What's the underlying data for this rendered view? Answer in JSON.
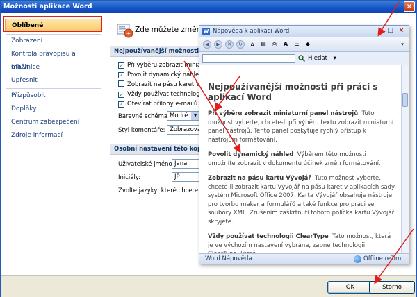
{
  "dialog": {
    "title": "Možnosti aplikace Word",
    "close": "×"
  },
  "nav": {
    "items": [
      {
        "label": "Oblíbené"
      },
      {
        "label": "Zobrazení"
      },
      {
        "label": "Kontrola pravopisu a mluvnice"
      },
      {
        "label": "Uložit"
      },
      {
        "label": "Upřesnit"
      },
      {
        "label": "Přizpůsobit"
      },
      {
        "label": "Doplňky"
      },
      {
        "label": "Centrum zabezpečení"
      },
      {
        "label": "Zdroje informací"
      }
    ]
  },
  "content": {
    "intro": "Zde můžete změnit ne",
    "section1": "Nejpoužívanější možnosti pro pr",
    "checks": [
      {
        "label": "Při výběru zobrazit miniatur",
        "checked": true
      },
      {
        "label": "Povolit dynamický náhled",
        "checked": true
      },
      {
        "label": "Zobrazit na pásu karet Vývo",
        "checked": false
      },
      {
        "label": "Vždy používat technologii C",
        "checked": true
      },
      {
        "label": "Otevírat přílohy e-mailů v r",
        "checked": true
      }
    ],
    "color_scheme_label": "Barevné schéma:",
    "color_scheme_value": "Modré",
    "tooltip_style_label": "Styl komentáře:",
    "tooltip_style_value": "Zobrazovat",
    "section2": "Osobní nastavení této kopie sad",
    "username_label": "Uživatelské jméno:",
    "username_value": "Jana",
    "initials_label": "Iniciály:",
    "initials_value": "JP",
    "languages_text": "Zvolte jazyky, které chcete pou"
  },
  "footer": {
    "ok": "OK",
    "cancel": "Storno"
  },
  "help": {
    "title": "Nápověda k aplikaci Word",
    "min": "_",
    "max": "□",
    "close": "×",
    "search_button": "Hledat",
    "search_arrow": "▾",
    "heading": "Nejpoužívanější možnosti při práci s aplikací Word",
    "paragraphs": [
      {
        "term": "Při výběru zobrazit miniaturní panel nástrojů",
        "text": "Tuto možnost vyberte, chcete-li při výběru textu zobrazit miniaturní panel nástrojů. Tento panel poskytuje rychlý přístup k nástrojům formátování."
      },
      {
        "term": "Povolit dynamický náhled",
        "text": "Výběrem této možnosti umožníte zobrazit v dokumentu účinek změn formátování."
      },
      {
        "term": "Zobrazit na pásu kartu Vývojář",
        "text": "Tuto možnost vyberte, chcete-li zobrazit kartu Vývojář na pásu karet v aplikacích sady systém Microsoft Office 2007. Karta Vývojář obsahuje nástroje pro tvorbu maker a formulářů a také funkce pro práci se soubory XML. Zrušením zaškrtnutí tohoto políčka kartu Vývojář skryjete."
      },
      {
        "term": "Vždy používat technologii ClearType",
        "text": "Tato možnost, která je ve výchozím nastavení vybrána, zapne technologii ClearType, která"
      }
    ],
    "status_left": "Word Nápověda",
    "status_right": "Offline režim"
  },
  "colors": {
    "title_bar": "#1452c8",
    "nav_highlight": "#e21d1d",
    "active_item": "#fbc96a",
    "arrow": "#e21d1d"
  }
}
